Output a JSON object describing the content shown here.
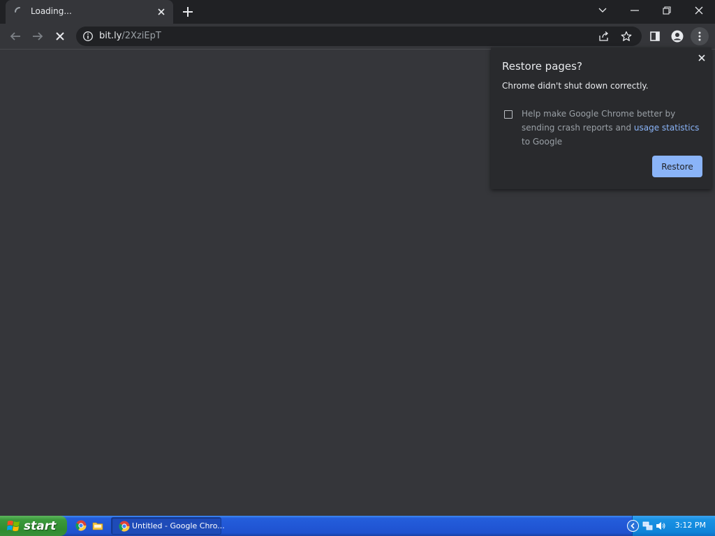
{
  "browser": {
    "tab": {
      "title": "Loading...",
      "icon": "loading-spinner-icon"
    },
    "url": {
      "host": "bit.ly",
      "path": "/2XziEpT"
    }
  },
  "restore_dialog": {
    "title": "Restore pages?",
    "message": "Chrome didn't shut down correctly.",
    "checkbox_checked": false,
    "help_text_before": "Help make Google Chrome better by sending crash reports and ",
    "help_link": "usage statistics",
    "help_text_after": " to Google",
    "button": "Restore"
  },
  "taskbar": {
    "start_label": "start",
    "task_label": "Untitled - Google Chro...",
    "clock": "3:12 PM"
  },
  "colors": {
    "tab_strip": "#202124",
    "toolbar": "#35363a",
    "omnibox": "#202124",
    "dialog": "#292a2d",
    "accent": "#8ab4f8",
    "taskbar": "#245edb",
    "start_button": "#3c9a3c"
  }
}
